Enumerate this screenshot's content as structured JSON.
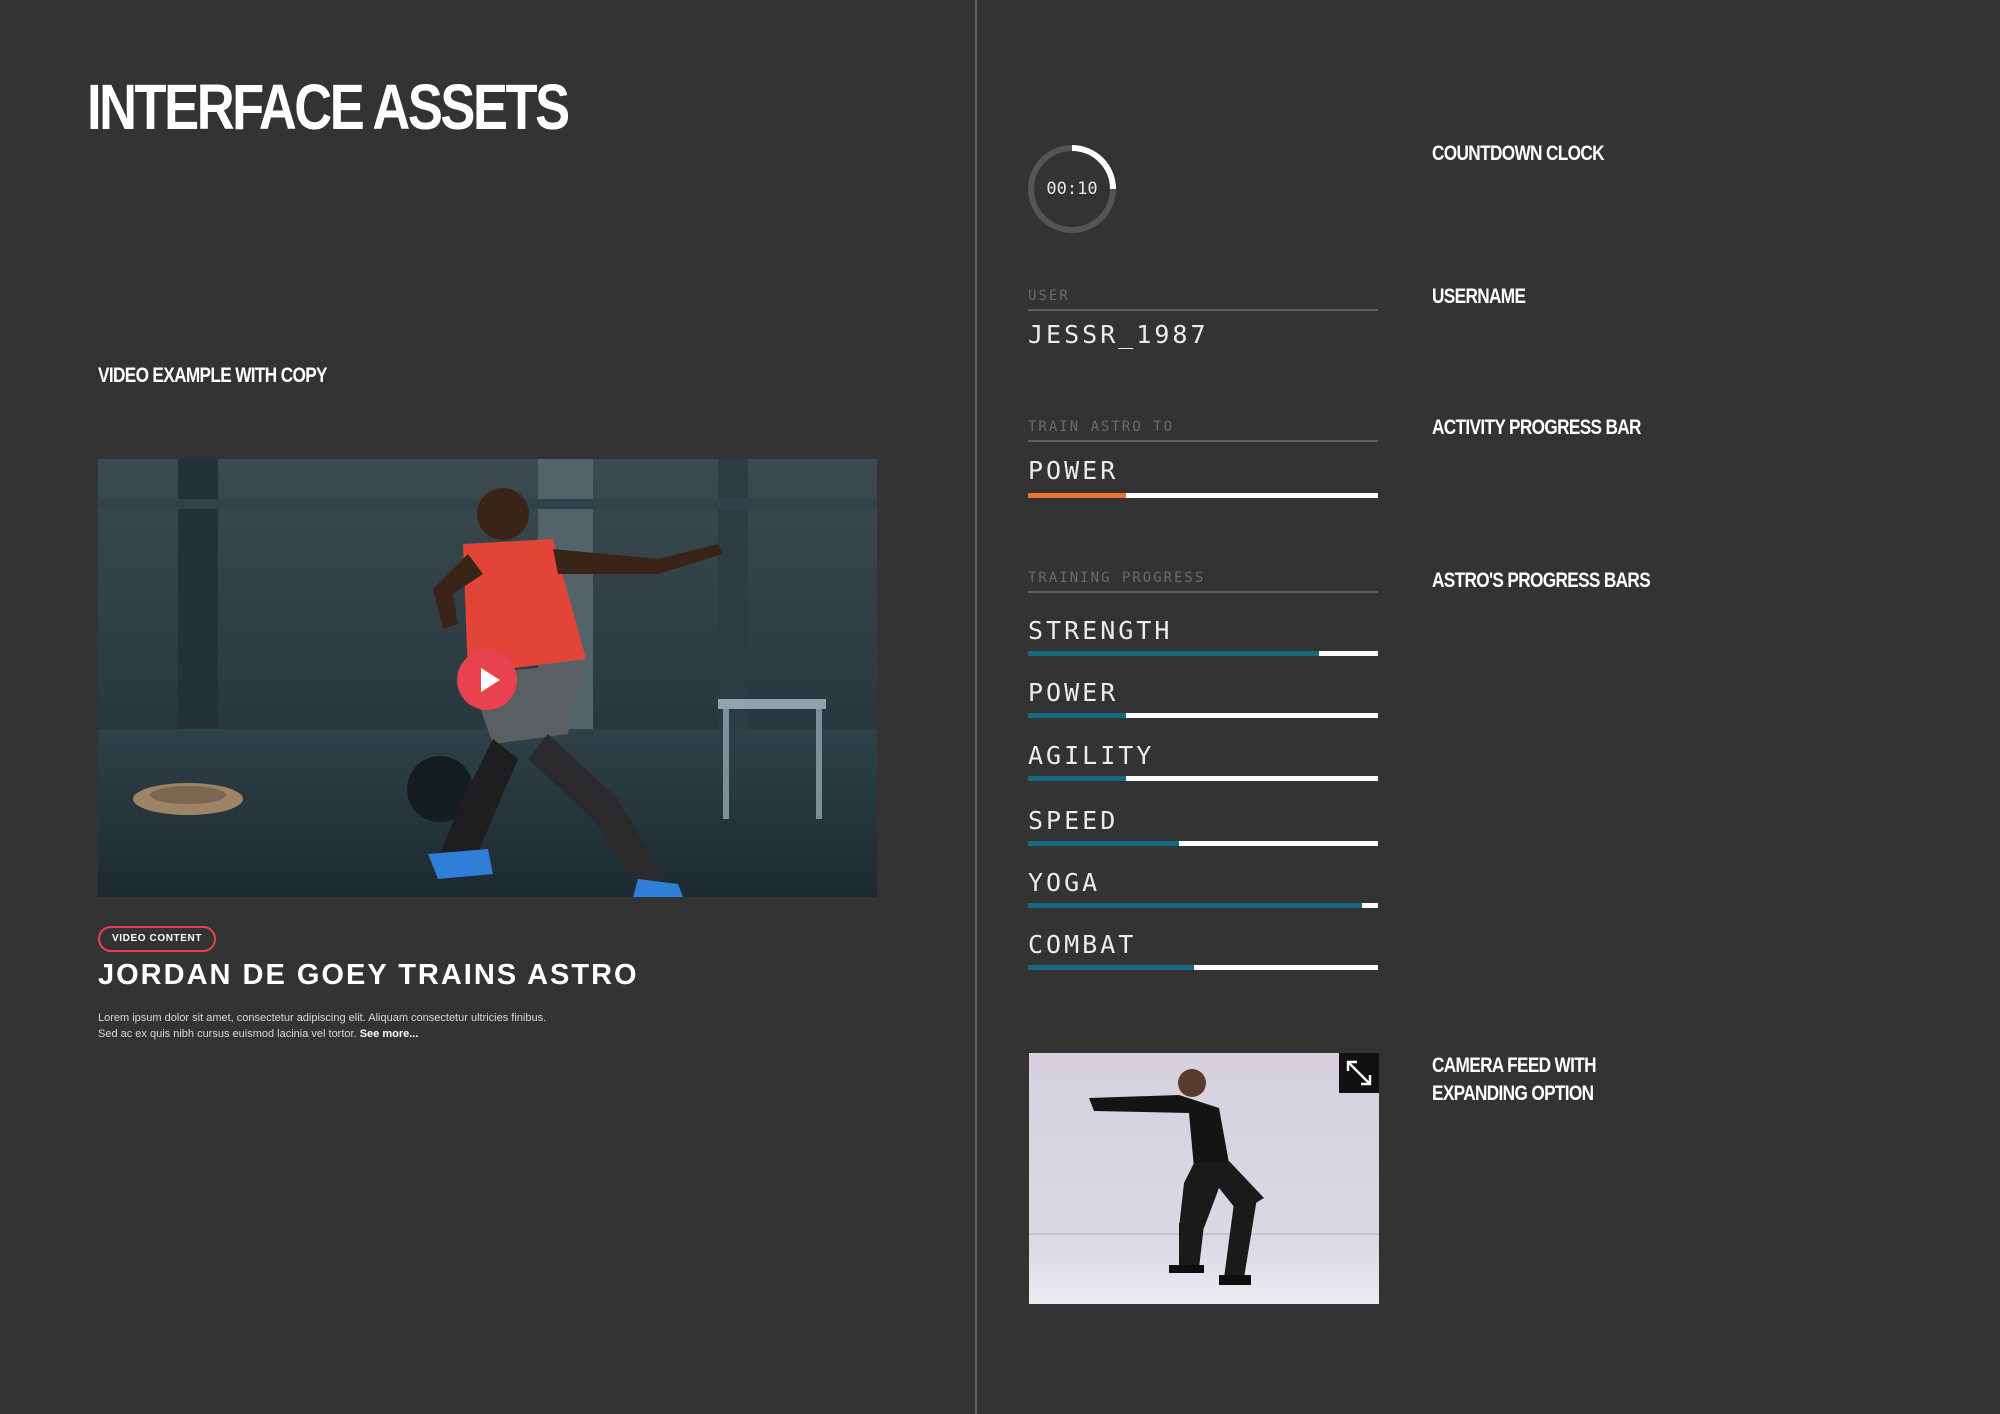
{
  "page": {
    "title": "INTERFACE ASSETS"
  },
  "labels": {
    "video_example": "VIDEO EXAMPLE WITH COPY",
    "countdown_clock": "COUNTDOWN CLOCK",
    "username": "USERNAME",
    "activity_progress_bar": "ACTIVITY PROGRESS BAR",
    "astros_progress_bars": "ASTRO'S PROGRESS BARS",
    "camera_feed_line1": "CAMERA FEED WITH",
    "camera_feed_line2": "EXPANDING OPTION"
  },
  "video": {
    "badge": "VIDEO CONTENT",
    "title": "JORDAN DE GOEY TRAINS ASTRO",
    "copy_line1": "Lorem ipsum dolor sit amet, consectetur adipiscing elit. Aliquam consectetur ultricies finibus.",
    "copy_line2": "Sed ac ex quis nibh cursus euismod lacinia vel tortor.",
    "see_more": "See more...",
    "play_icon": "play-icon"
  },
  "countdown": {
    "time": "00:10",
    "progress_fraction": 0.25,
    "ring_color": "#555555",
    "arc_color": "#ffffff"
  },
  "user": {
    "label": "USER",
    "value": "JESSR_1987"
  },
  "activity": {
    "label": "TRAIN ASTRO TO",
    "value": "POWER",
    "progress_fraction": 0.28,
    "fill_color": "#ed7334"
  },
  "training": {
    "label": "TRAINING PROGRESS",
    "fill_color": "#17697f",
    "bars": [
      {
        "name": "STRENGTH",
        "progress_fraction": 0.83
      },
      {
        "name": "POWER",
        "progress_fraction": 0.28
      },
      {
        "name": "AGILITY",
        "progress_fraction": 0.28
      },
      {
        "name": "SPEED",
        "progress_fraction": 0.43
      },
      {
        "name": "YOGA",
        "progress_fraction": 0.955
      },
      {
        "name": "COMBAT",
        "progress_fraction": 0.475
      }
    ]
  },
  "camera": {
    "expand_icon": "expand-icon"
  },
  "colors": {
    "background": "#333333",
    "accent_red": "#e9414f",
    "text": "#ffffff"
  }
}
